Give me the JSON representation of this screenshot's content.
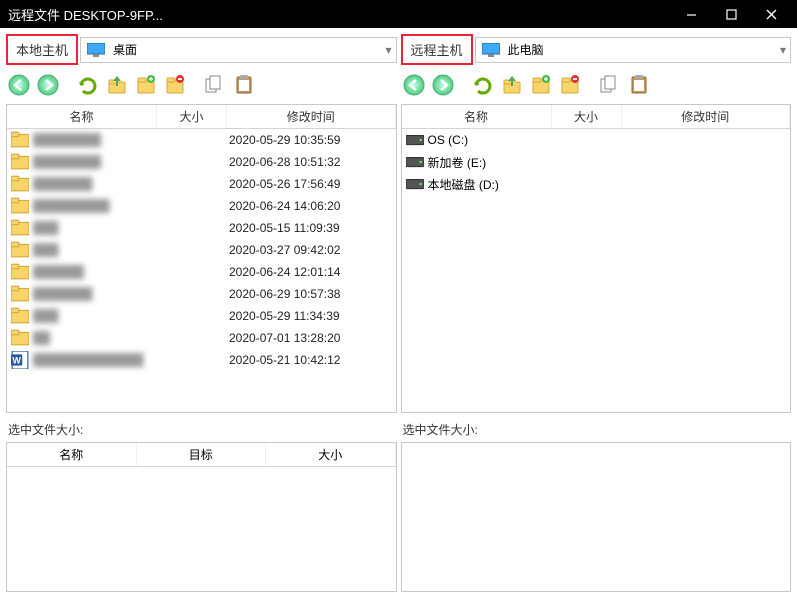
{
  "title": "远程文件 DESKTOP-9FP...",
  "local": {
    "label": "本地主机",
    "path": "桌面",
    "cols": {
      "name": "名称",
      "size": "大小",
      "time": "修改时间"
    },
    "files": [
      {
        "type": "folder",
        "name": "████████",
        "time": "2020-05-29 10:35:59"
      },
      {
        "type": "folder",
        "name": "████████",
        "time": "2020-06-28 10:51:32"
      },
      {
        "type": "folder",
        "name": "███████",
        "time": "2020-05-26 17:56:49"
      },
      {
        "type": "folder",
        "name": "█████████",
        "time": "2020-06-24 14:06:20"
      },
      {
        "type": "folder",
        "name": "███",
        "time": "2020-05-15 11:09:39"
      },
      {
        "type": "folder",
        "name": "███",
        "time": "2020-03-27 09:42:02"
      },
      {
        "type": "folder",
        "name": "██████",
        "time": "2020-06-24 12:01:14"
      },
      {
        "type": "folder",
        "name": "███████",
        "time": "2020-06-29 10:57:38"
      },
      {
        "type": "folder",
        "name": "███",
        "time": "2020-05-29 11:34:39"
      },
      {
        "type": "folder",
        "name": "██",
        "time": "2020-07-01 13:28:20"
      },
      {
        "type": "word",
        "name": "█████████████",
        "time": "2020-05-21 10:42:12"
      }
    ],
    "selected_label": "选中文件大小:",
    "sel_cols": {
      "name": "名称",
      "target": "目标",
      "size": "大小"
    }
  },
  "remote": {
    "label": "远程主机",
    "path": "此电脑",
    "cols": {
      "name": "名称",
      "size": "大小",
      "time": "修改时间"
    },
    "drives": [
      {
        "type": "drive",
        "name": "OS (C:)"
      },
      {
        "type": "drive",
        "name": "新加卷 (E:)"
      },
      {
        "type": "drive",
        "name": "本地磁盘 (D:)"
      }
    ],
    "selected_label": "选中文件大小:"
  }
}
